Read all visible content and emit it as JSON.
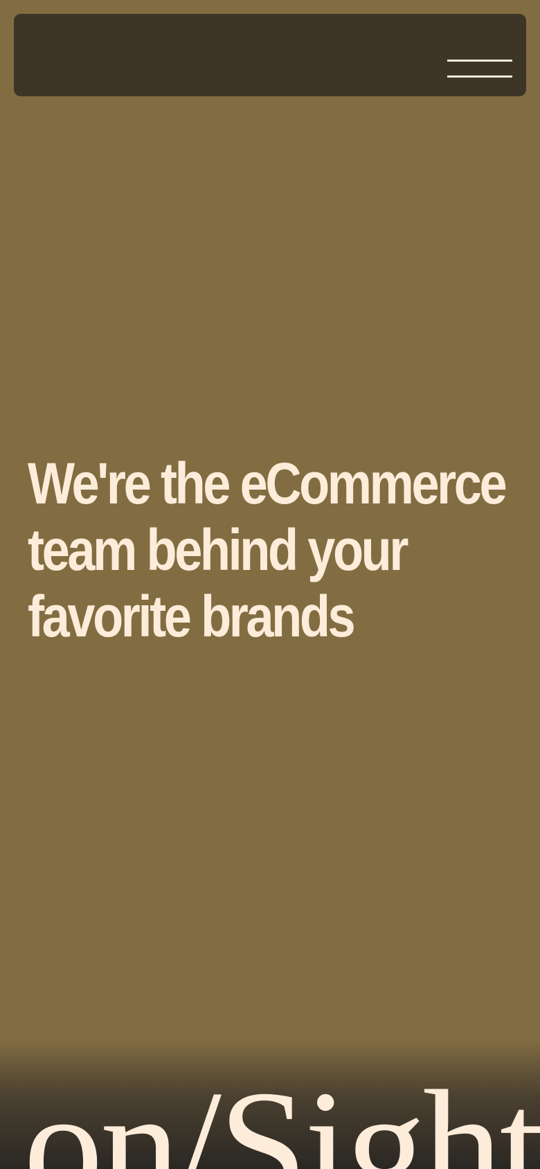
{
  "header": {
    "menu_icon": "hamburger-menu-icon"
  },
  "hero": {
    "headline": "We're the eCommerce team behind your favorite brands"
  },
  "brand": {
    "wordmark": "on/Sight"
  },
  "colors": {
    "background": "#826d42",
    "navbar": "#3d3528",
    "text": "#fdecd9"
  }
}
